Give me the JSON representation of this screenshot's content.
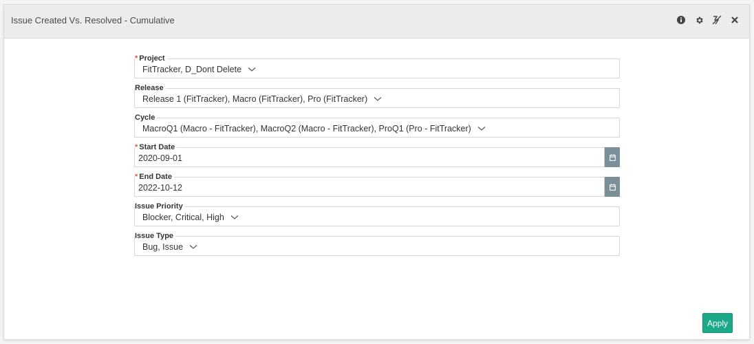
{
  "widget": {
    "title": "Issue Created Vs. Resolved - Cumulative",
    "header_icons": [
      "info-icon",
      "gear-icon",
      "collapse-icon",
      "close-icon"
    ]
  },
  "form": {
    "required_mark": "*",
    "project": {
      "label": "Project",
      "value": "FitTracker, D_Dont Delete"
    },
    "release": {
      "label": "Release",
      "value": "Release 1 (FitTracker), Macro (FitTracker), Pro (FitTracker)"
    },
    "cycle": {
      "label": "Cycle",
      "value": "MacroQ1 (Macro - FitTracker), MacroQ2 (Macro - FitTracker), ProQ1 (Pro - FitTracker)"
    },
    "start_date": {
      "label": "Start Date",
      "value": "2020-09-01"
    },
    "end_date": {
      "label": "End Date",
      "value": "2022-10-12"
    },
    "issue_priority": {
      "label": "Issue Priority",
      "value": "Blocker, Critical, High"
    },
    "issue_type": {
      "label": "Issue Type",
      "value": "Bug, Issue"
    }
  },
  "actions": {
    "apply_label": "Apply"
  },
  "colors": {
    "apply": "#1aaa8a",
    "calendar_button": "#7b8f99",
    "required": "#d9534f"
  }
}
